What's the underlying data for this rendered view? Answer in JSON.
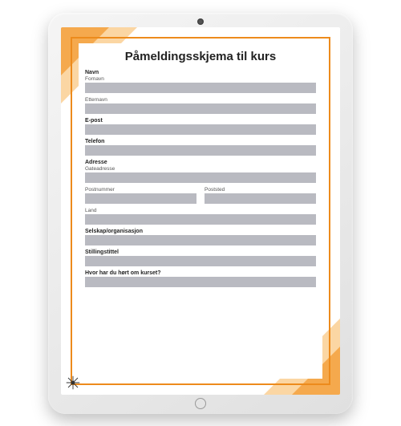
{
  "form": {
    "title": "Påmeldingsskjema til kurs",
    "name_label": "Navn",
    "firstname_label": "Fornavn",
    "lastname_label": "Etternavn",
    "email_label": "E-post",
    "phone_label": "Telefon",
    "address_label": "Adresse",
    "street_label": "Gateadresse",
    "postcode_label": "Postnummer",
    "city_label": "Poststed",
    "country_label": "Land",
    "company_label": "Selskap/organisasjon",
    "jobtitle_label": "Stillingstittel",
    "heard_label": "Hvor har du hørt om kurset?"
  }
}
